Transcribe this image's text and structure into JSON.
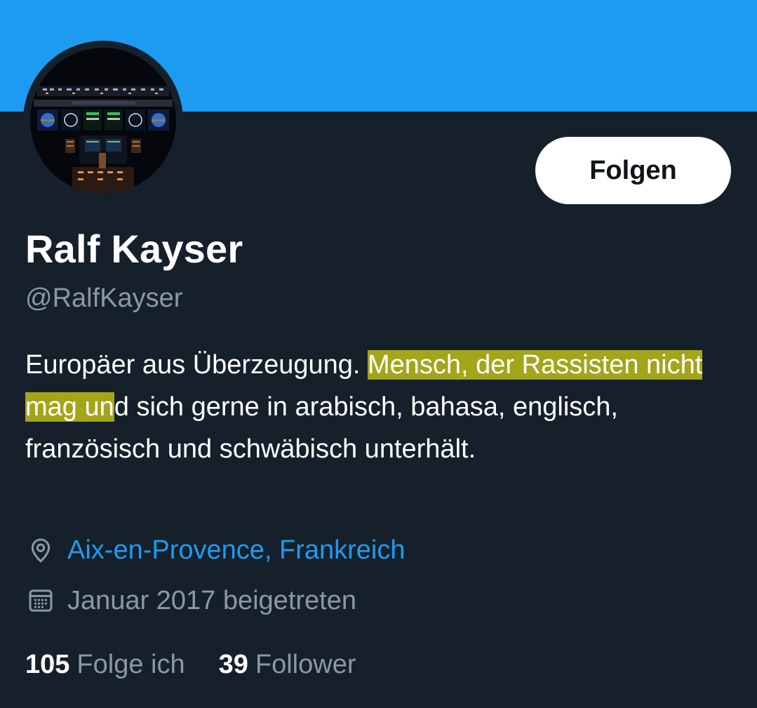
{
  "profile": {
    "follow_label": "Folgen",
    "display_name": "Ralf Kayser",
    "handle": "@RalfKayser",
    "bio": {
      "part1": "Europäer aus Überzeugung. ",
      "highlight": "Mensch, der Rassisten nicht mag un",
      "part2": "d sich gerne in arabisch, bahasa, englisch, französisch und schwäbisch unterhält."
    },
    "location": "Aix-en-Provence, Frankreich",
    "joined": "Januar 2017 beigetreten",
    "following_count": "105",
    "following_label": "Folge ich",
    "followers_count": "39",
    "followers_label": "Follower"
  },
  "colors": {
    "banner": "#1d9bf0",
    "background": "#15202b",
    "link": "#1d9bf0",
    "secondary_text": "#8b98a5",
    "highlight": "#a3a51a"
  },
  "icons": {
    "location": "location-pin-icon",
    "calendar": "calendar-icon"
  }
}
